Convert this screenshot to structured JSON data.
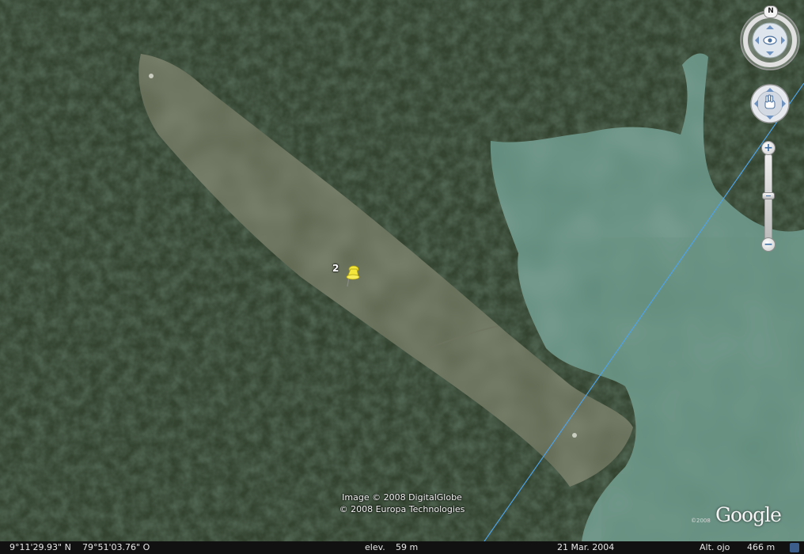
{
  "map": {
    "type": "satellite",
    "colors": {
      "forest": "#33432f",
      "clearing": "#5e6650",
      "water": "#5d8879",
      "line": "#4fa3e8",
      "pin": "#f4e63a"
    }
  },
  "placemark": {
    "label": "2",
    "icon": "pushpin-icon"
  },
  "attribution": {
    "line1": "Image © 2008 DigitalGlobe",
    "line2": "© 2008 Europa Technologies"
  },
  "logo": {
    "text": "Google",
    "year": "©2008"
  },
  "navigation": {
    "north_label": "N",
    "look_icon": "eye-icon",
    "move_icon": "hand-icon",
    "zoom_in": "+",
    "zoom_out": "−"
  },
  "status": {
    "latitude": "9°11'29.93\" N",
    "longitude": "79°51'03.76\" O",
    "elev_label": "elev.",
    "elev_value": "59 m",
    "date": "21 Mar. 2004",
    "eye_alt_label": "Alt. ojo",
    "eye_alt_value": "466 m"
  }
}
